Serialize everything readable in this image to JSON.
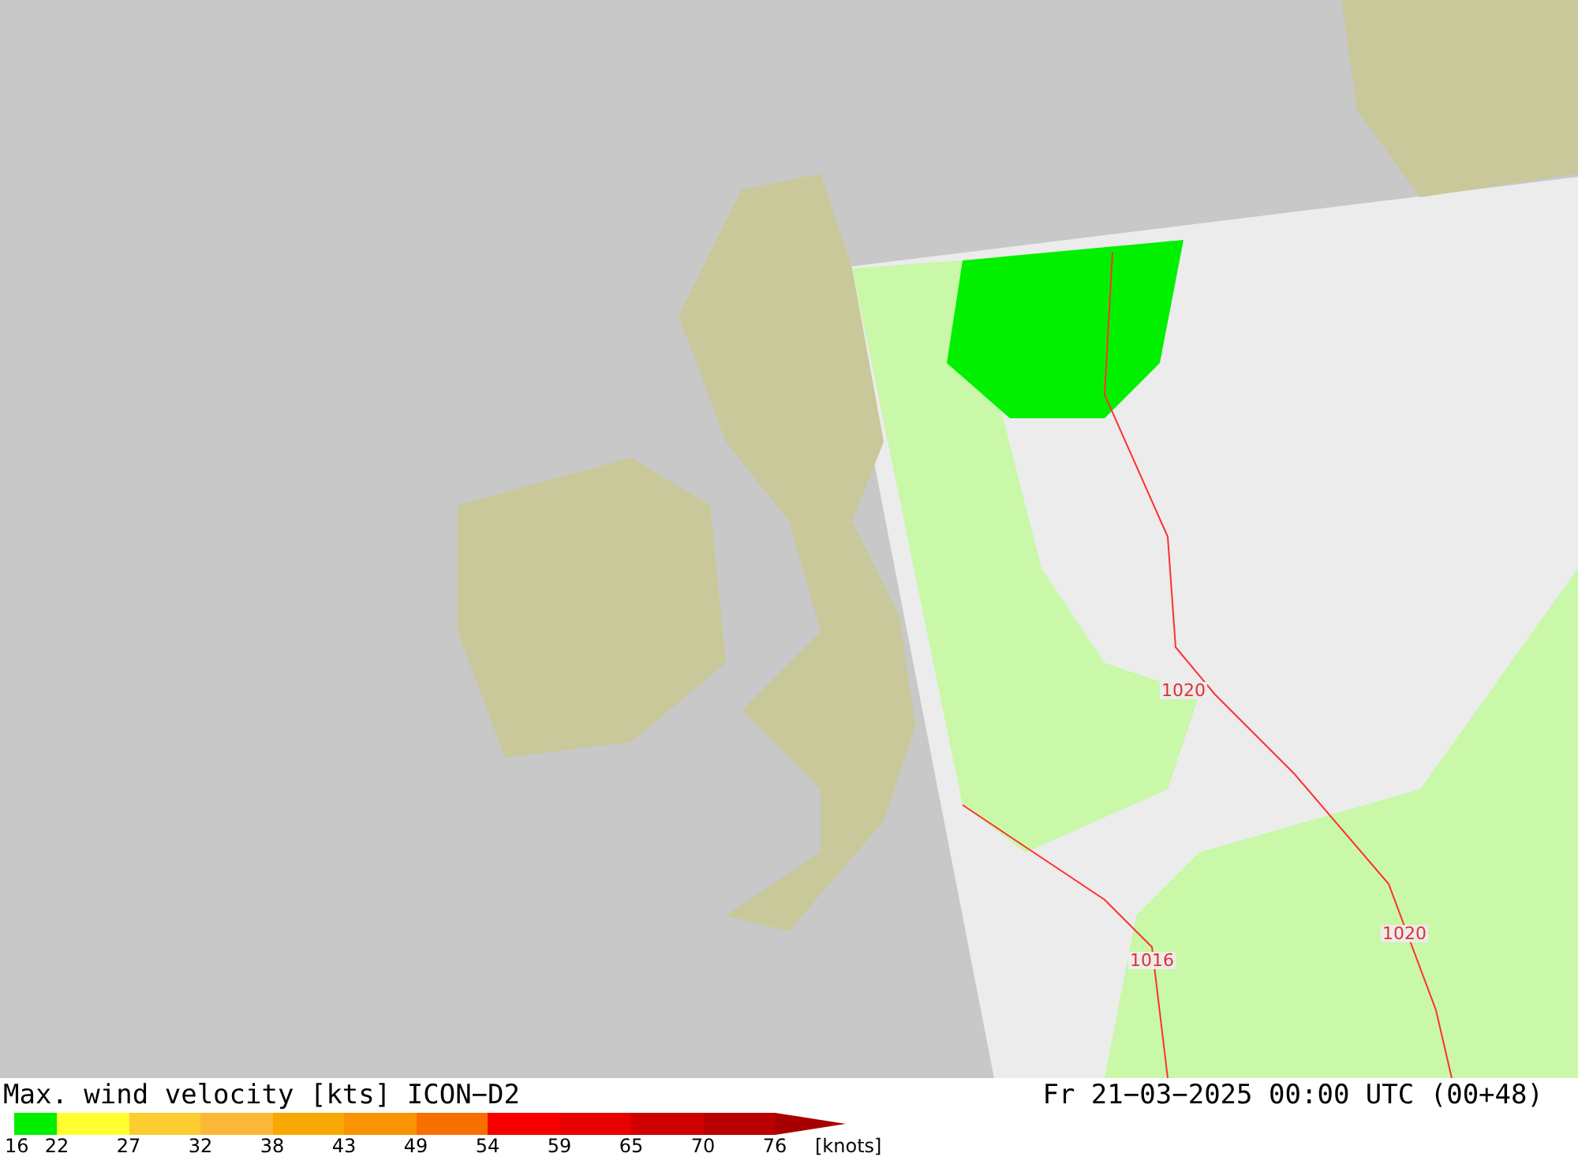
{
  "map": {
    "isobar_labels": [
      "1020",
      "1016",
      "1020"
    ]
  },
  "footer": {
    "title": "Max. wind velocity [kts] ICON−D2",
    "timestamp": "Fr 21−03−2025 00:00 UTC (00+48)"
  },
  "legend": {
    "unit": "[knots]",
    "segments": [
      {
        "label": "16",
        "color": "#00ee00",
        "kind": "bar"
      },
      {
        "label": "22",
        "color": "#ffff30",
        "kind": "bar"
      },
      {
        "label": "27",
        "color": "#fccc30",
        "kind": "bar"
      },
      {
        "label": "32",
        "color": "#fbb838",
        "kind": "bar"
      },
      {
        "label": "38",
        "color": "#f8a800",
        "kind": "bar"
      },
      {
        "label": "43",
        "color": "#f89400",
        "kind": "bar"
      },
      {
        "label": "49",
        "color": "#f87000",
        "kind": "bar"
      },
      {
        "label": "54",
        "color": "#f80000",
        "kind": "bar"
      },
      {
        "label": "59",
        "color": "#e80000",
        "kind": "bar"
      },
      {
        "label": "65",
        "color": "#d00000",
        "kind": "bar"
      },
      {
        "label": "70",
        "color": "#b80000",
        "kind": "bar"
      },
      {
        "label": "76",
        "color": "#a80000",
        "kind": "arrow"
      }
    ]
  }
}
